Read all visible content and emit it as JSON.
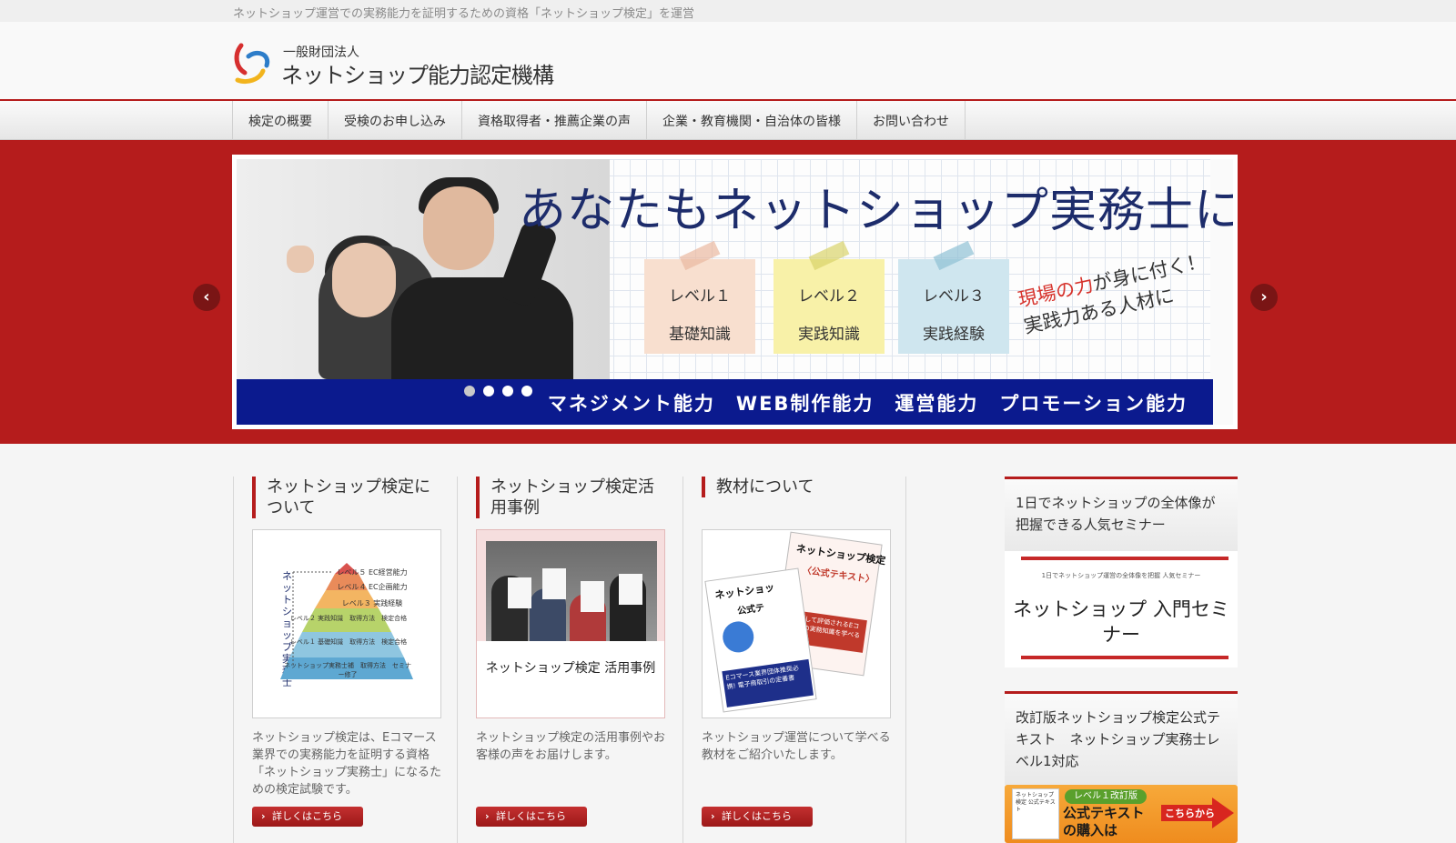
{
  "topbar": {
    "tagline": "ネットショップ運営での実務能力を証明するための資格「ネットショップ検定」を運営"
  },
  "logo": {
    "sub": "一般財団法人",
    "main": "ネットショップ能力認定機構"
  },
  "nav": {
    "items": [
      {
        "label": "検定の概要"
      },
      {
        "label": "受検のお申し込み"
      },
      {
        "label": "資格取得者・推薦企業の声"
      },
      {
        "label": "企業・教育機関・自治体の皆様"
      },
      {
        "label": "お問い合わせ"
      }
    ]
  },
  "hero": {
    "headline": "あなたもネットショップ実務士に",
    "notes": [
      {
        "level": "レベル１",
        "topic": "基礎知識"
      },
      {
        "level": "レベル２",
        "topic": "実践知識"
      },
      {
        "level": "レベル３",
        "topic": "実践経験"
      }
    ],
    "handwriting_red": "現場の力",
    "handwriting_1": "が身に付く！",
    "handwriting_2": "実践力ある人材に",
    "band": "マネジメント能力　WEB制作能力　運営能力　プロモーション能力",
    "prev_icon": "chevron-left-icon",
    "next_icon": "chevron-right-icon",
    "prev_glyph": "‹",
    "next_glyph": "›",
    "active_slide": 1,
    "slide_count": 4
  },
  "columns": [
    {
      "title": "ネットショップ検定について",
      "text": "ネットショップ検定は、Eコマース業界での実務能力を証明する資格「ネットショップ実務士」になるための検定試験です。",
      "button": "詳しくはこちら"
    },
    {
      "title": "ネットショップ検定活用事例",
      "text": "ネットショップ検定の活用事例やお客様の声をお届けします。",
      "button": "詳しくはこちら"
    },
    {
      "title": "教材について",
      "text": "ネットショップ運営について学べる教材をご紹介いたします。",
      "button": "詳しくはこちら"
    }
  ],
  "pyramid": {
    "side_label": "ネットショップ実務士",
    "tiers": [
      {
        "label": "レベル５ EC経営能力",
        "color": "#d9534f"
      },
      {
        "label": "レベル４ EC企画能力",
        "color": "#e98b5a"
      },
      {
        "label": "レベル３ 実践経験",
        "color": "#f3b562"
      },
      {
        "label": "レベル２ 実践知識　取得方法　検定合格",
        "color": "#b7d36a"
      },
      {
        "label": "レベル１ 基礎知識　取得方法　検定合格",
        "color": "#8fc6e0"
      },
      {
        "label": "ネットショップ実務士補　取得方法　セミナー修了",
        "color": "#5ea8d2"
      }
    ]
  },
  "case_thumb": {
    "caption": "ネットショップ検定 活用事例"
  },
  "books": {
    "book1_title": "ネットショップ検定",
    "book1_sub": "〈公式テキスト〉",
    "book1_band": "プロとして評価されるEコマースの実務知識を学べる一冊！",
    "book2_title": "ネットショッ",
    "book2_sub": "公式テ",
    "book2_band": "Eコマース業界団体推奨必携! 電子商取引の定番書"
  },
  "sidebar": {
    "seminar_heading": "1日でネットショップの全体像が把握できる人気セミナー",
    "seminar_small": "1日でネットショップ運営の全体像を把握 人気セミナー",
    "seminar_big": "ネットショップ 入門セミナー",
    "text_heading": "改訂版ネットショップ検定公式テキスト　ネットショップ実務士レベル1対応",
    "banner_badge": "レベル１改訂版",
    "banner_text_1": "公式テキスト",
    "banner_text_2": "の購入は",
    "banner_cta": "こちらから",
    "banner_mini": "ネットショップ検定 公式テキスト"
  },
  "colors": {
    "brand_red": "#b51c1c",
    "band_blue": "#0b1a8e",
    "cta_orange": "#f39c2e"
  }
}
